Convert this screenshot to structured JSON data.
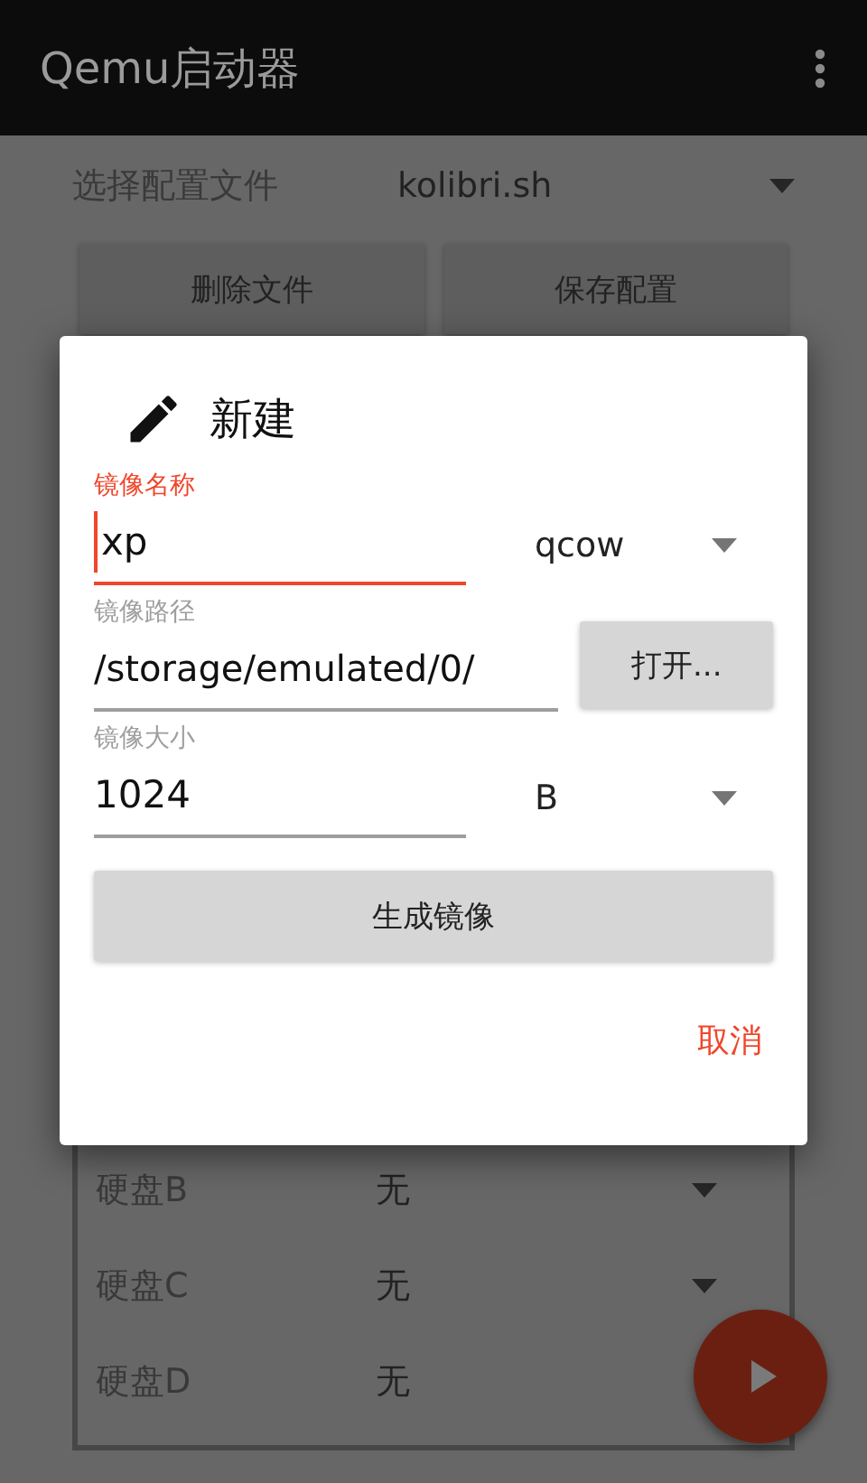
{
  "app_bar": {
    "title": "Qemu启动器"
  },
  "config": {
    "label": "选择配置文件",
    "value": "kolibri.sh"
  },
  "actions": [
    "删除文件",
    "保存配置"
  ],
  "dialog": {
    "title": "新建",
    "fields": [
      {
        "kind": "select",
        "label": "镜像名称",
        "value": "xp",
        "focused": true,
        "option": "qcow"
      },
      {
        "kind": "browse",
        "label": "镜像路径",
        "value": "/storage/emulated/0/",
        "focused": false,
        "button": "打开..."
      },
      {
        "kind": "select",
        "label": "镜像大小",
        "value": "1024",
        "focused": false,
        "option": "B"
      }
    ],
    "create_button": "生成镜像",
    "cancel_button": "取消"
  },
  "disks": [
    {
      "label": "硬盘B",
      "value": "无",
      "arrow": true
    },
    {
      "label": "硬盘C",
      "value": "无",
      "arrow": true
    },
    {
      "label": "硬盘D",
      "value": "无",
      "arrow": false
    }
  ]
}
